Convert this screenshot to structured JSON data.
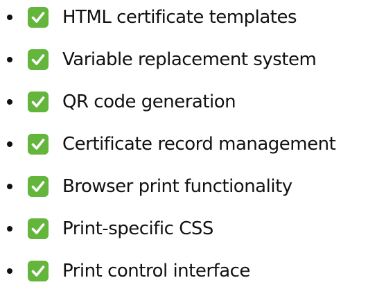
{
  "checklist": {
    "items": [
      {
        "label": "HTML certificate templates",
        "checked": true,
        "icon": "check-mark-button-icon"
      },
      {
        "label": "Variable replacement system",
        "checked": true,
        "icon": "check-mark-button-icon"
      },
      {
        "label": "QR code generation",
        "checked": true,
        "icon": "check-mark-button-icon"
      },
      {
        "label": "Certificate record management",
        "checked": true,
        "icon": "check-mark-button-icon"
      },
      {
        "label": "Browser print functionality",
        "checked": true,
        "icon": "check-mark-button-icon"
      },
      {
        "label": "Print-specific CSS",
        "checked": true,
        "icon": "check-mark-button-icon"
      },
      {
        "label": "Print control interface",
        "checked": true,
        "icon": "check-mark-button-icon"
      }
    ],
    "colors": {
      "check_bg": "#64b53b",
      "check_mark": "#ffffff",
      "text": "#111111"
    }
  }
}
